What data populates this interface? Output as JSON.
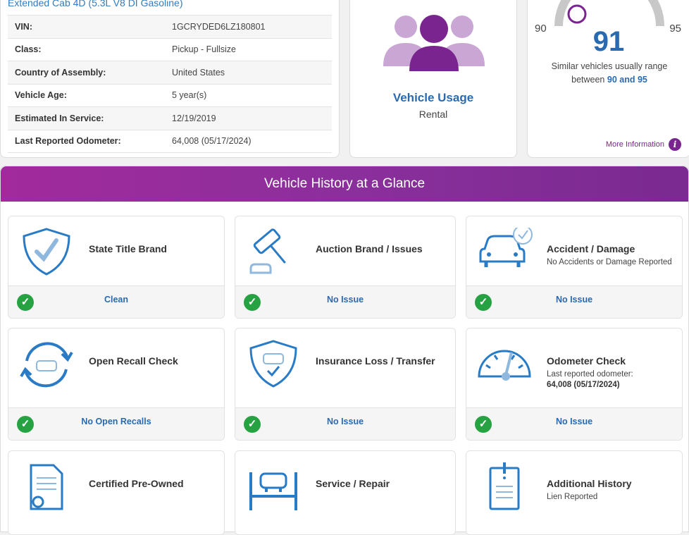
{
  "vehicle": {
    "subtitle": "Extended Cab 4D (5.3L V8 DI Gasoline)",
    "specs": [
      {
        "label": "VIN:",
        "value": "1GCRYDED6LZ180801"
      },
      {
        "label": "Class:",
        "value": "Pickup - Fullsize"
      },
      {
        "label": "Country of Assembly:",
        "value": "United States"
      },
      {
        "label": "Vehicle Age:",
        "value": "5 year(s)"
      },
      {
        "label": "Estimated In Service:",
        "value": "12/19/2019"
      },
      {
        "label": "Last Reported Odometer:",
        "value": "64,008 (05/17/2024)"
      }
    ]
  },
  "usage": {
    "title": "Vehicle Usage",
    "value": "Rental",
    "icon": "people-group-icon"
  },
  "range": {
    "min": "90",
    "max": "95",
    "value": "91",
    "desc_prefix": "Similar vehicles usually range between",
    "desc_range": "90 and 95",
    "more_info": "More Information",
    "colors": {
      "accent": "#2a6ab0",
      "marker": "#7a2490",
      "arc": "#c8c8c8"
    }
  },
  "history": {
    "title": "Vehicle History at a Glance",
    "tiles": [
      {
        "title": "State Title Brand",
        "desc": "",
        "status": "Clean",
        "icon": "shield-check-icon"
      },
      {
        "title": "Auction Brand / Issues",
        "desc": "",
        "status": "No Issue",
        "icon": "gavel-icon"
      },
      {
        "title": "Accident / Damage",
        "desc": "No Accidents or Damage Reported",
        "status": "No Issue",
        "icon": "car-check-icon"
      },
      {
        "title": "Open Recall Check",
        "desc": "",
        "status": "No Open Recalls",
        "icon": "recall-cycle-icon"
      },
      {
        "title": "Insurance Loss / Transfer",
        "desc": "",
        "status": "No Issue",
        "icon": "insurance-shield-icon"
      },
      {
        "title": "Odometer Check",
        "desc": "Last reported odometer:",
        "desc_bold": "64,008 (05/17/2024)",
        "status": "No Issue",
        "icon": "odometer-icon"
      },
      {
        "title": "Certified Pre-Owned",
        "desc": "",
        "icon": "certificate-icon"
      },
      {
        "title": "Service / Repair",
        "desc": "",
        "icon": "car-lift-icon"
      },
      {
        "title": "Additional History",
        "desc": "Lien Reported",
        "icon": "clipboard-alert-icon"
      }
    ],
    "check_color": "#27a243"
  }
}
